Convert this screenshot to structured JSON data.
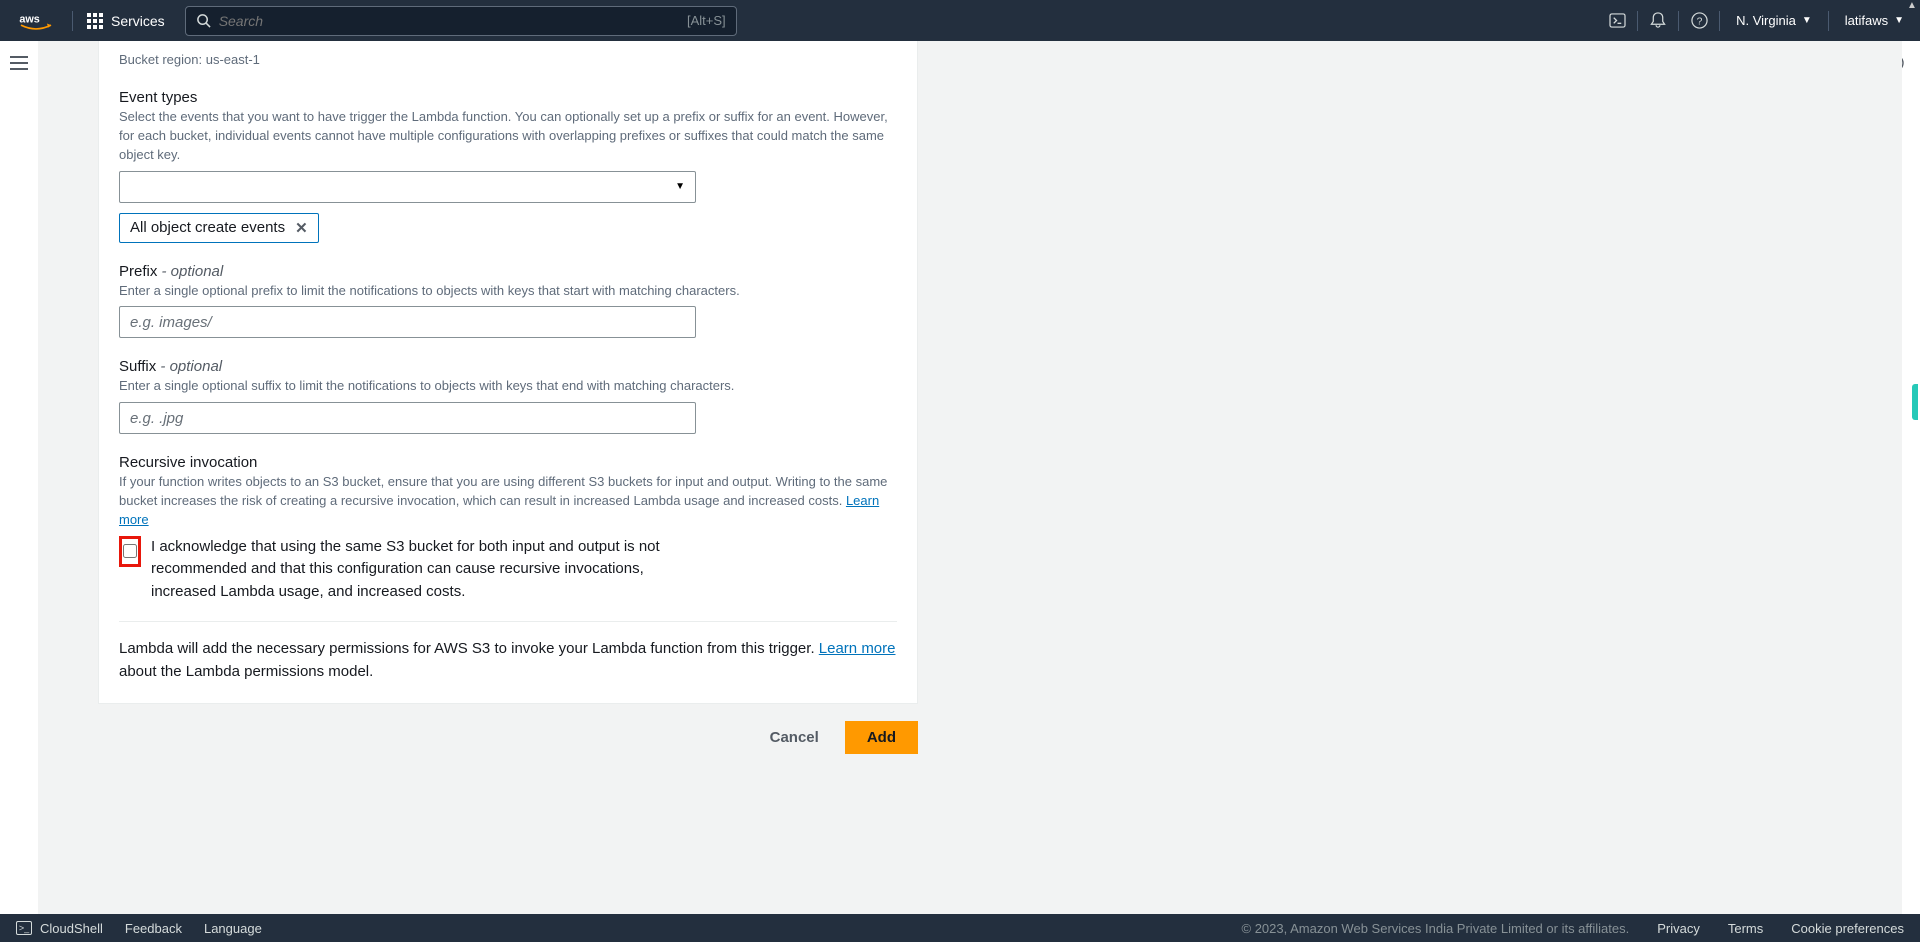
{
  "nav": {
    "services": "Services",
    "search_placeholder": "Search",
    "shortcut": "[Alt+S]",
    "region": "N. Virginia",
    "user": "latifaws"
  },
  "form": {
    "bucket_region_label": "Bucket region: us-east-1",
    "event_types": {
      "label": "Event types",
      "desc": "Select the events that you want to have trigger the Lambda function. You can optionally set up a prefix or suffix for an event. However, for each bucket, individual events cannot have multiple configurations with overlapping prefixes or suffixes that could match the same object key.",
      "chip": "All object create events"
    },
    "prefix": {
      "label": "Prefix",
      "optional": " - optional",
      "desc": "Enter a single optional prefix to limit the notifications to objects with keys that start with matching characters.",
      "placeholder": "e.g. images/"
    },
    "suffix": {
      "label": "Suffix",
      "optional": " - optional",
      "desc": "Enter a single optional suffix to limit the notifications to objects with keys that end with matching characters.",
      "placeholder": "e.g. .jpg"
    },
    "recursive": {
      "label": "Recursive invocation",
      "desc": "If your function writes objects to an S3 bucket, ensure that you are using different S3 buckets for input and output. Writing to the same bucket increases the risk of creating a recursive invocation, which can result in increased Lambda usage and increased costs. ",
      "learn_more": "Learn more",
      "ack": "I acknowledge that using the same S3 bucket for both input and output is not recommended and that this configuration can cause recursive invocations, increased Lambda usage, and increased costs."
    },
    "perm_note_a": "Lambda will add the necessary permissions for AWS S3 to invoke your Lambda function from this trigger. ",
    "perm_note_link": "Learn more",
    "perm_note_b": " about the Lambda permissions model."
  },
  "actions": {
    "cancel": "Cancel",
    "add": "Add"
  },
  "footer": {
    "cloudshell": "CloudShell",
    "feedback": "Feedback",
    "language": "Language",
    "copyright": "© 2023, Amazon Web Services India Private Limited or its affiliates.",
    "privacy": "Privacy",
    "terms": "Terms",
    "cookies": "Cookie preferences"
  }
}
